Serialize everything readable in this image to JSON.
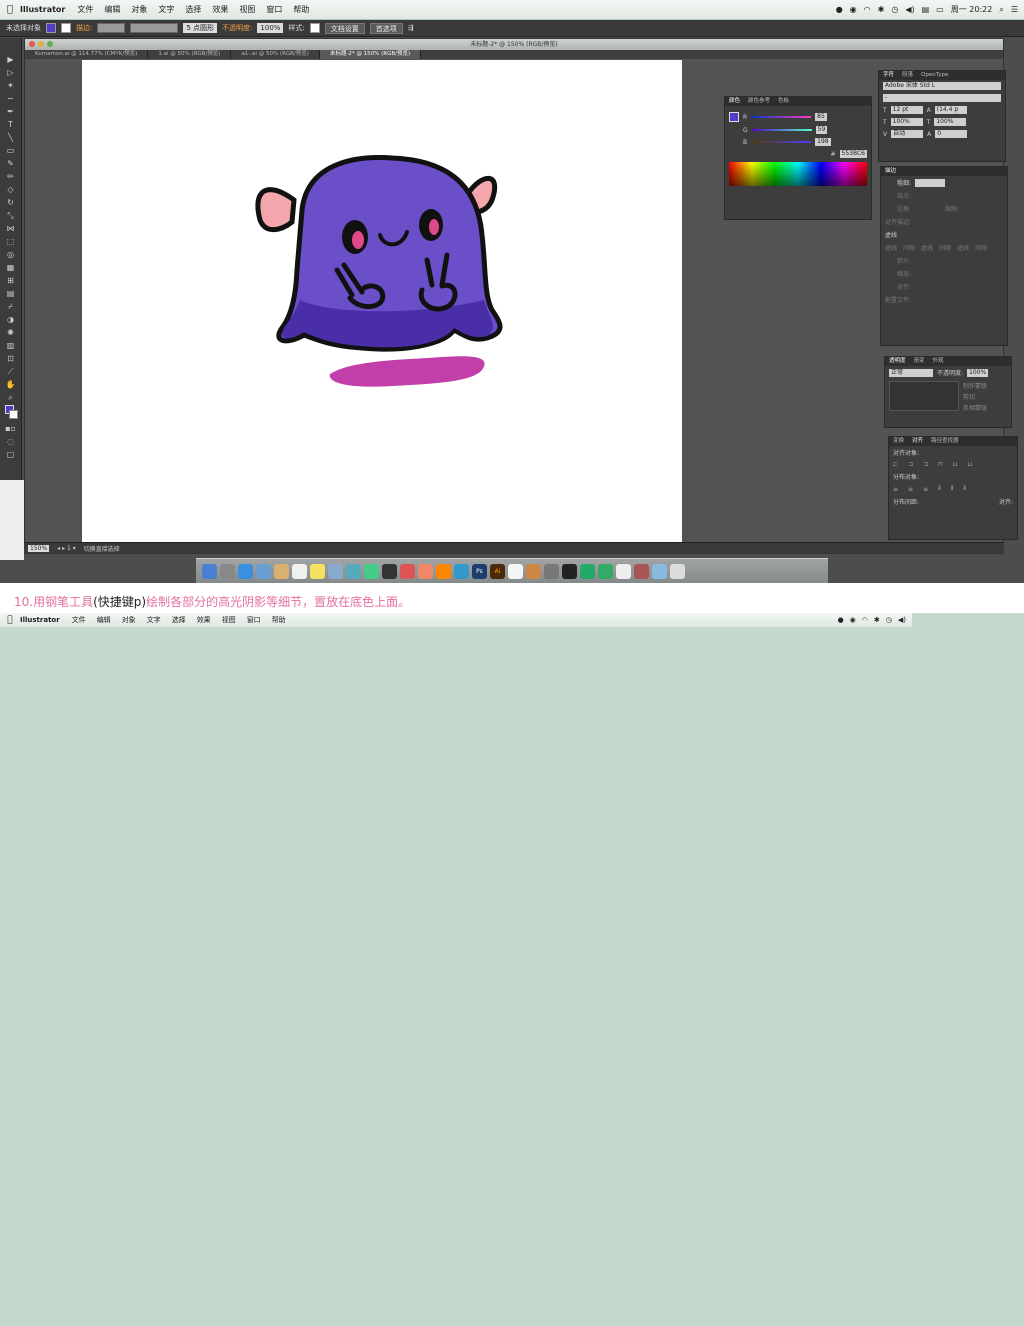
{
  "menubar": {
    "app_name": "Illustrator",
    "items": [
      "文件",
      "编辑",
      "对象",
      "文字",
      "选择",
      "效果",
      "视图",
      "窗口",
      "帮助"
    ],
    "clock": "周一 20:22"
  },
  "control_bar": {
    "selection_label": "未选择对象",
    "stroke_label": "描边:",
    "brush_label": "5 点圆形",
    "opacity_label": "不透明度:",
    "opacity_value": "100%",
    "style_label": "样式:",
    "doc_setup_button": "文档设置",
    "prefs_button": "首选项"
  },
  "document": {
    "title": "未标题-2* @ 150% (RGB/预览)",
    "tabs": [
      "Kumamon.ai @ 114.77% (CMYK/预览)",
      "1.ai @ 50% (RGB/预览)",
      "a1-.ai @ 50% (RGB/预览)",
      "未标题-2* @ 150% (RGB/预览)"
    ]
  },
  "status_bar": {
    "zoom": "150%",
    "tool_label": "切换直接选择"
  },
  "color_panel": {
    "tabs": [
      "颜色",
      "颜色参考",
      "色板"
    ],
    "r_label": "R",
    "r_value": "85",
    "g_label": "G",
    "g_value": "59",
    "b_label": "B",
    "b_value": "198",
    "hex_label": "#",
    "hex_value": "553BC6"
  },
  "char_panel": {
    "tabs": [
      "字符",
      "段落",
      "OpenType"
    ],
    "font": "Adobe 宋体 Std L",
    "style": "-",
    "size": "12 pt",
    "leading": "(14.4 p",
    "h_scale": "100%",
    "v_scale": "100%",
    "tracking": "自动",
    "kerning": "0"
  },
  "stroke_panel": {
    "title": "描边",
    "weight_label": "粗细:",
    "cap_label": "端点:",
    "corner_label": "边角:",
    "limit_label": "限制:",
    "align_label": "对齐描边:",
    "dash_label": "虚线",
    "dash_sub": [
      "虚线",
      "间隙",
      "虚线",
      "间隙",
      "虚线",
      "间隙"
    ],
    "arrow_label": "箭头:",
    "scale_label": "缩放:",
    "align2_label": "对齐:",
    "profile_label": "配置文件:"
  },
  "transparency_panel": {
    "tabs": [
      "透明度",
      "渐变",
      "外观"
    ],
    "mode": "正常",
    "opacity_label": "不透明度:",
    "opacity_value": "100%",
    "make_mask": "制作蒙版",
    "clip": "剪切",
    "invert": "反相蒙版"
  },
  "align_panel": {
    "tabs": [
      "变换",
      "对齐",
      "路径查找器"
    ],
    "align_objects": "对齐对象:",
    "distribute_objects": "分布对象:",
    "distribute_spacing": "分布间距:",
    "align_to": "对齐:"
  },
  "caption": {
    "part1": "10.用钢笔工具",
    "part2": "(快捷键p)",
    "part3": "绘制各部分的高光阴影等细节，置放在底色上面。"
  },
  "menubar2": {
    "app_name": "Illustrator",
    "items": [
      "文件",
      "编辑",
      "对象",
      "文字",
      "选择",
      "效果",
      "视图",
      "窗口",
      "帮助"
    ]
  },
  "colors": {
    "monster_body": "#6a4fc9",
    "monster_shade": "#4a2ea8",
    "horn": "#f3a6ac",
    "puddle": "#c23ea8",
    "background": "#c4d9cc",
    "caption": "#e46fa0"
  }
}
